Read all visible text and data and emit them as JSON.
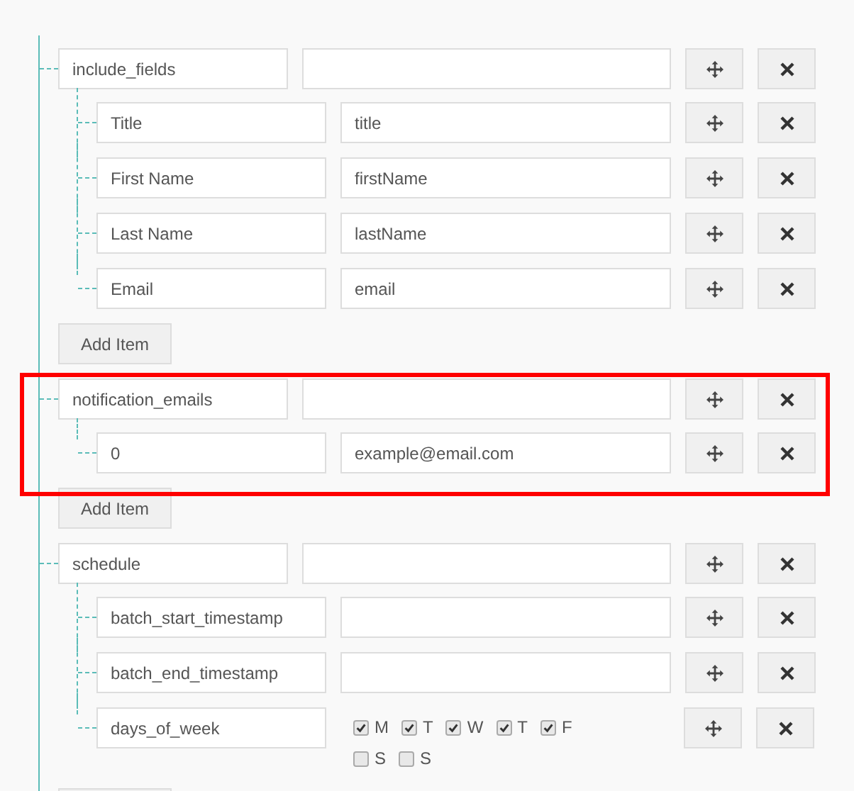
{
  "groups": [
    {
      "key": "include_fields",
      "highlighted": false,
      "add_label": "Add Item",
      "children": [
        {
          "kind": "text",
          "key": "Title",
          "value": "title"
        },
        {
          "kind": "text",
          "key": "First Name",
          "value": "firstName"
        },
        {
          "kind": "text",
          "key": "Last Name",
          "value": "lastName"
        },
        {
          "kind": "text",
          "key": "Email",
          "value": "email"
        }
      ]
    },
    {
      "key": "notification_emails",
      "highlighted": true,
      "add_label": "Add Item",
      "children": [
        {
          "kind": "text",
          "key": "0",
          "value": "example@email.com"
        }
      ]
    },
    {
      "key": "schedule",
      "highlighted": false,
      "children": [
        {
          "kind": "text",
          "key": "batch_start_timestamp"
        },
        {
          "kind": "text",
          "key": "batch_end_timestamp"
        },
        {
          "kind": "days",
          "key": "days_of_week",
          "days": [
            {
              "label": "M",
              "checked": true
            },
            {
              "label": "T",
              "checked": true
            },
            {
              "label": "W",
              "checked": true
            },
            {
              "label": "T",
              "checked": true
            },
            {
              "label": "F",
              "checked": true
            },
            {
              "label": "S",
              "checked": false
            },
            {
              "label": "S",
              "checked": false
            }
          ]
        }
      ]
    }
  ]
}
